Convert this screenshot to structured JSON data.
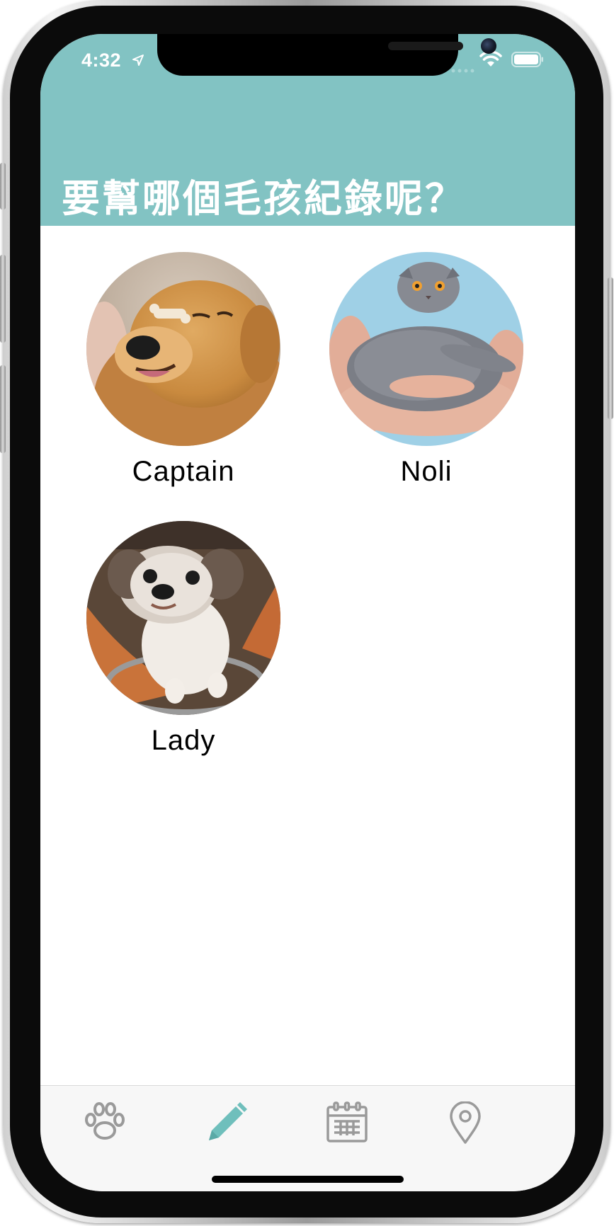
{
  "status_bar": {
    "time": "4:32",
    "location_icon": "location-arrow-icon",
    "wifi_icon": "wifi-icon",
    "battery_icon": "battery-icon"
  },
  "header": {
    "title": "要幫哪個毛孩紀錄呢？",
    "background_color": "#82c3c3"
  },
  "pets": [
    {
      "name": "Captain",
      "photo": "golden-retriever-photo"
    },
    {
      "name": "Noli",
      "photo": "gray-scottish-fold-cat-photo"
    },
    {
      "name": "Lady",
      "photo": "shih-tzu-dog-photo"
    }
  ],
  "tab_bar": {
    "tabs": [
      {
        "icon": "paw-icon",
        "selected": false
      },
      {
        "icon": "pencil-icon",
        "selected": true
      },
      {
        "icon": "calendar-icon",
        "selected": false
      },
      {
        "icon": "map-pin-icon",
        "selected": false
      }
    ],
    "accent_color": "#6fbfbc",
    "inactive_color": "#9a9a9a"
  }
}
